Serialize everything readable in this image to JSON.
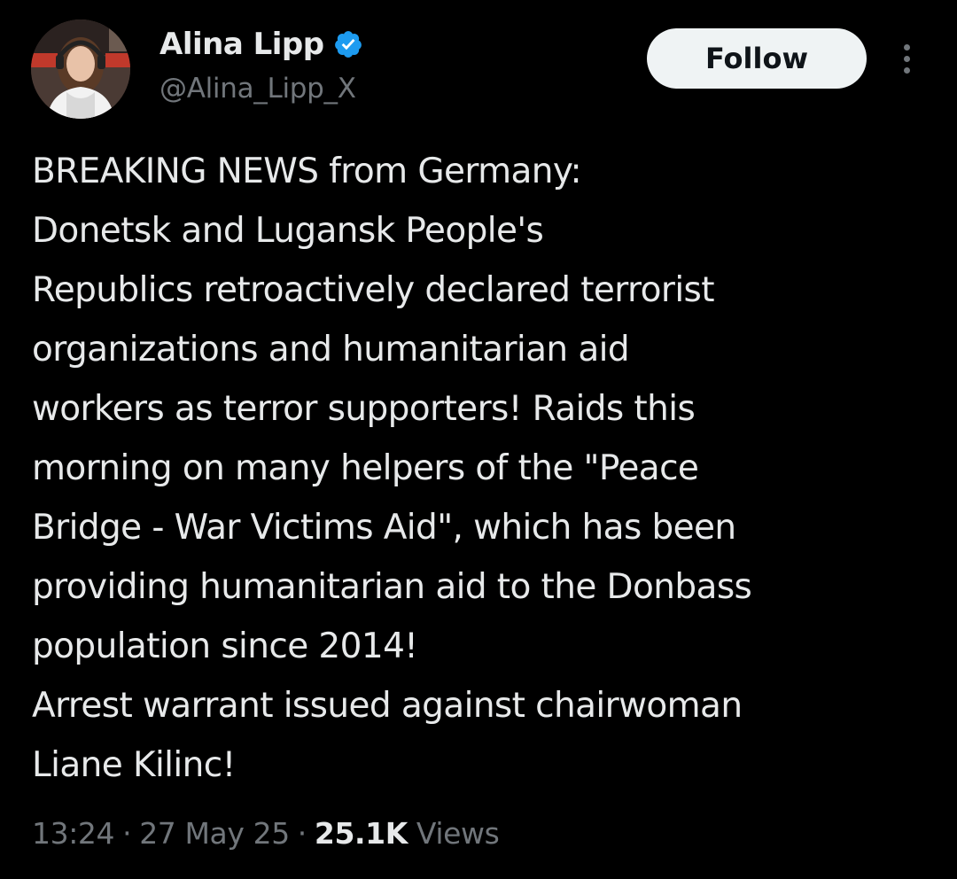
{
  "author": {
    "display_name": "Alina Lipp",
    "handle": "@Alina_Lipp_X",
    "verified": true,
    "avatar_icon": "profile-photo"
  },
  "actions": {
    "follow_label": "Follow",
    "more_icon": "more-dots-icon"
  },
  "tweet": {
    "lines": [
      "BREAKING NEWS from Germany:",
      "Donetsk and Lugansk People's",
      "Republics retroactively declared terrorist",
      "organizations and humanitarian aid",
      "workers as terror supporters! Raids this",
      "morning on many helpers of the \"Peace",
      "Bridge - War Victims Aid\", which has been",
      "providing humanitarian aid to the Donbass",
      "population since 2014!",
      "Arrest warrant issued against chairwoman",
      "Liane Kilinc!"
    ]
  },
  "meta": {
    "time": "13:24",
    "date": "27 May 25",
    "separator": "·",
    "views_count": "25.1K",
    "views_label": "Views"
  },
  "colors": {
    "background": "#000000",
    "primary_text": "#e7e9ea",
    "secondary_text": "#71767b",
    "verified_blue": "#1d9bf0",
    "follow_bg": "#eff3f4",
    "follow_text": "#0f1419"
  }
}
